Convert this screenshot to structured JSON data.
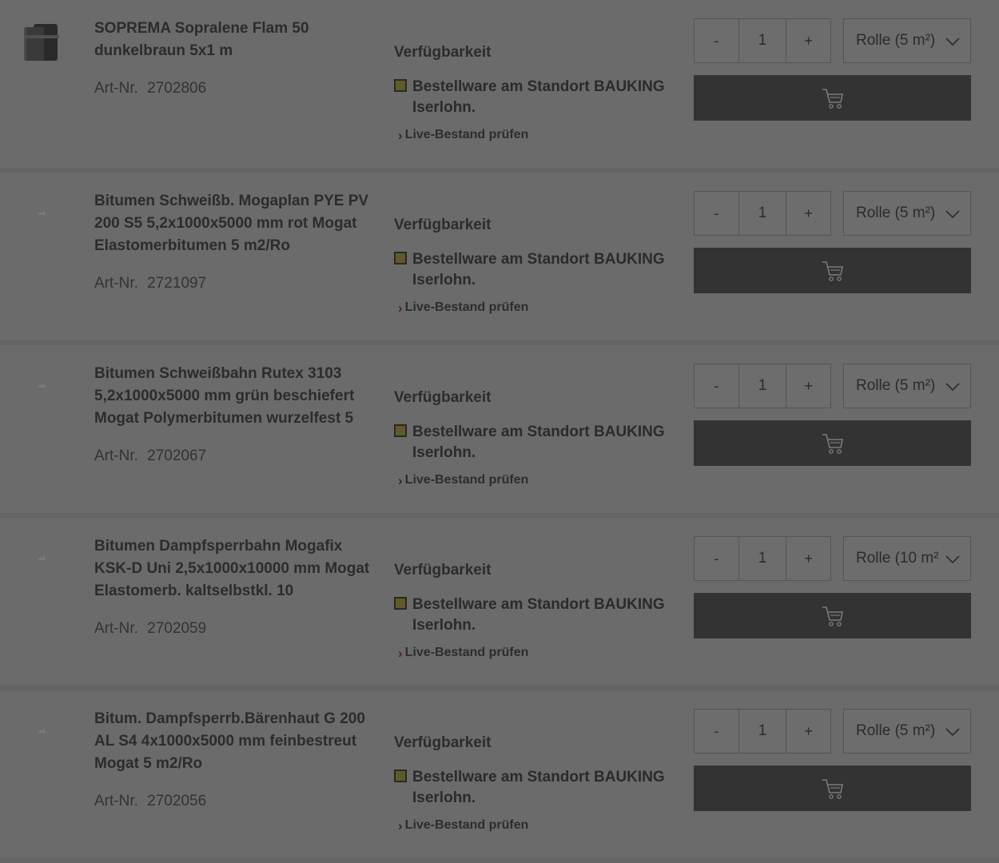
{
  "availability_heading": "Verfügbarkeit",
  "live_stock_link": "Live-Bestand prüfen",
  "artnr_label": "Art-Nr.",
  "qty_minus": "-",
  "qty_plus": "+",
  "products": [
    {
      "title": "SOPREMA Sopralene Flam 50 dunkelbraun 5x1 m",
      "artnr": "2702806",
      "availability": "Bestellware am Standort BAUKING Iserlohn.",
      "quantity": "1",
      "unit": "Rolle (5 m²)",
      "has_image": true
    },
    {
      "title": "Bitumen Schweißb. Mogaplan PYE PV 200 S5 5,2x1000x5000 mm rot Mogat Elastomerbitumen 5 m2/Ro",
      "artnr": "2721097",
      "availability": "Bestellware am Standort BAUKING Iserlohn.",
      "quantity": "1",
      "unit": "Rolle (5 m²)",
      "has_image": false
    },
    {
      "title": "Bitumen Schweißbahn Rutex 3103 5,2x1000x5000 mm grün beschiefert Mogat Polymerbitumen wurzelfest 5",
      "artnr": "2702067",
      "availability": "Bestellware am Standort BAUKING Iserlohn.",
      "quantity": "1",
      "unit": "Rolle (5 m²)",
      "has_image": false
    },
    {
      "title": "Bitumen Dampfsperrbahn Mogafix KSK-D Uni 2,5x1000x10000 mm Mogat Elastomerb. kaltselbstkl. 10",
      "artnr": "2702059",
      "availability": "Bestellware am Standort BAUKING Iserlohn.",
      "quantity": "1",
      "unit": "Rolle (10 m²",
      "has_image": false
    },
    {
      "title": "Bitum. Dampfsperrb.Bärenhaut G 200 AL S4 4x1000x5000 mm feinbestreut Mogat 5 m2/Ro",
      "artnr": "2702056",
      "availability": "Bestellware am Standort BAUKING Iserlohn.",
      "quantity": "1",
      "unit": "Rolle (5 m²)",
      "has_image": false
    }
  ],
  "icons": {
    "cart": "cart-icon",
    "dropdown": "chevron-down-icon",
    "link": "chevron-right-icon",
    "availability_status": "availability-status-icon"
  },
  "colors": {
    "overlay_background": "#6a6a6a",
    "cart_button": "#333333",
    "status_box": "#5f5a2e"
  }
}
